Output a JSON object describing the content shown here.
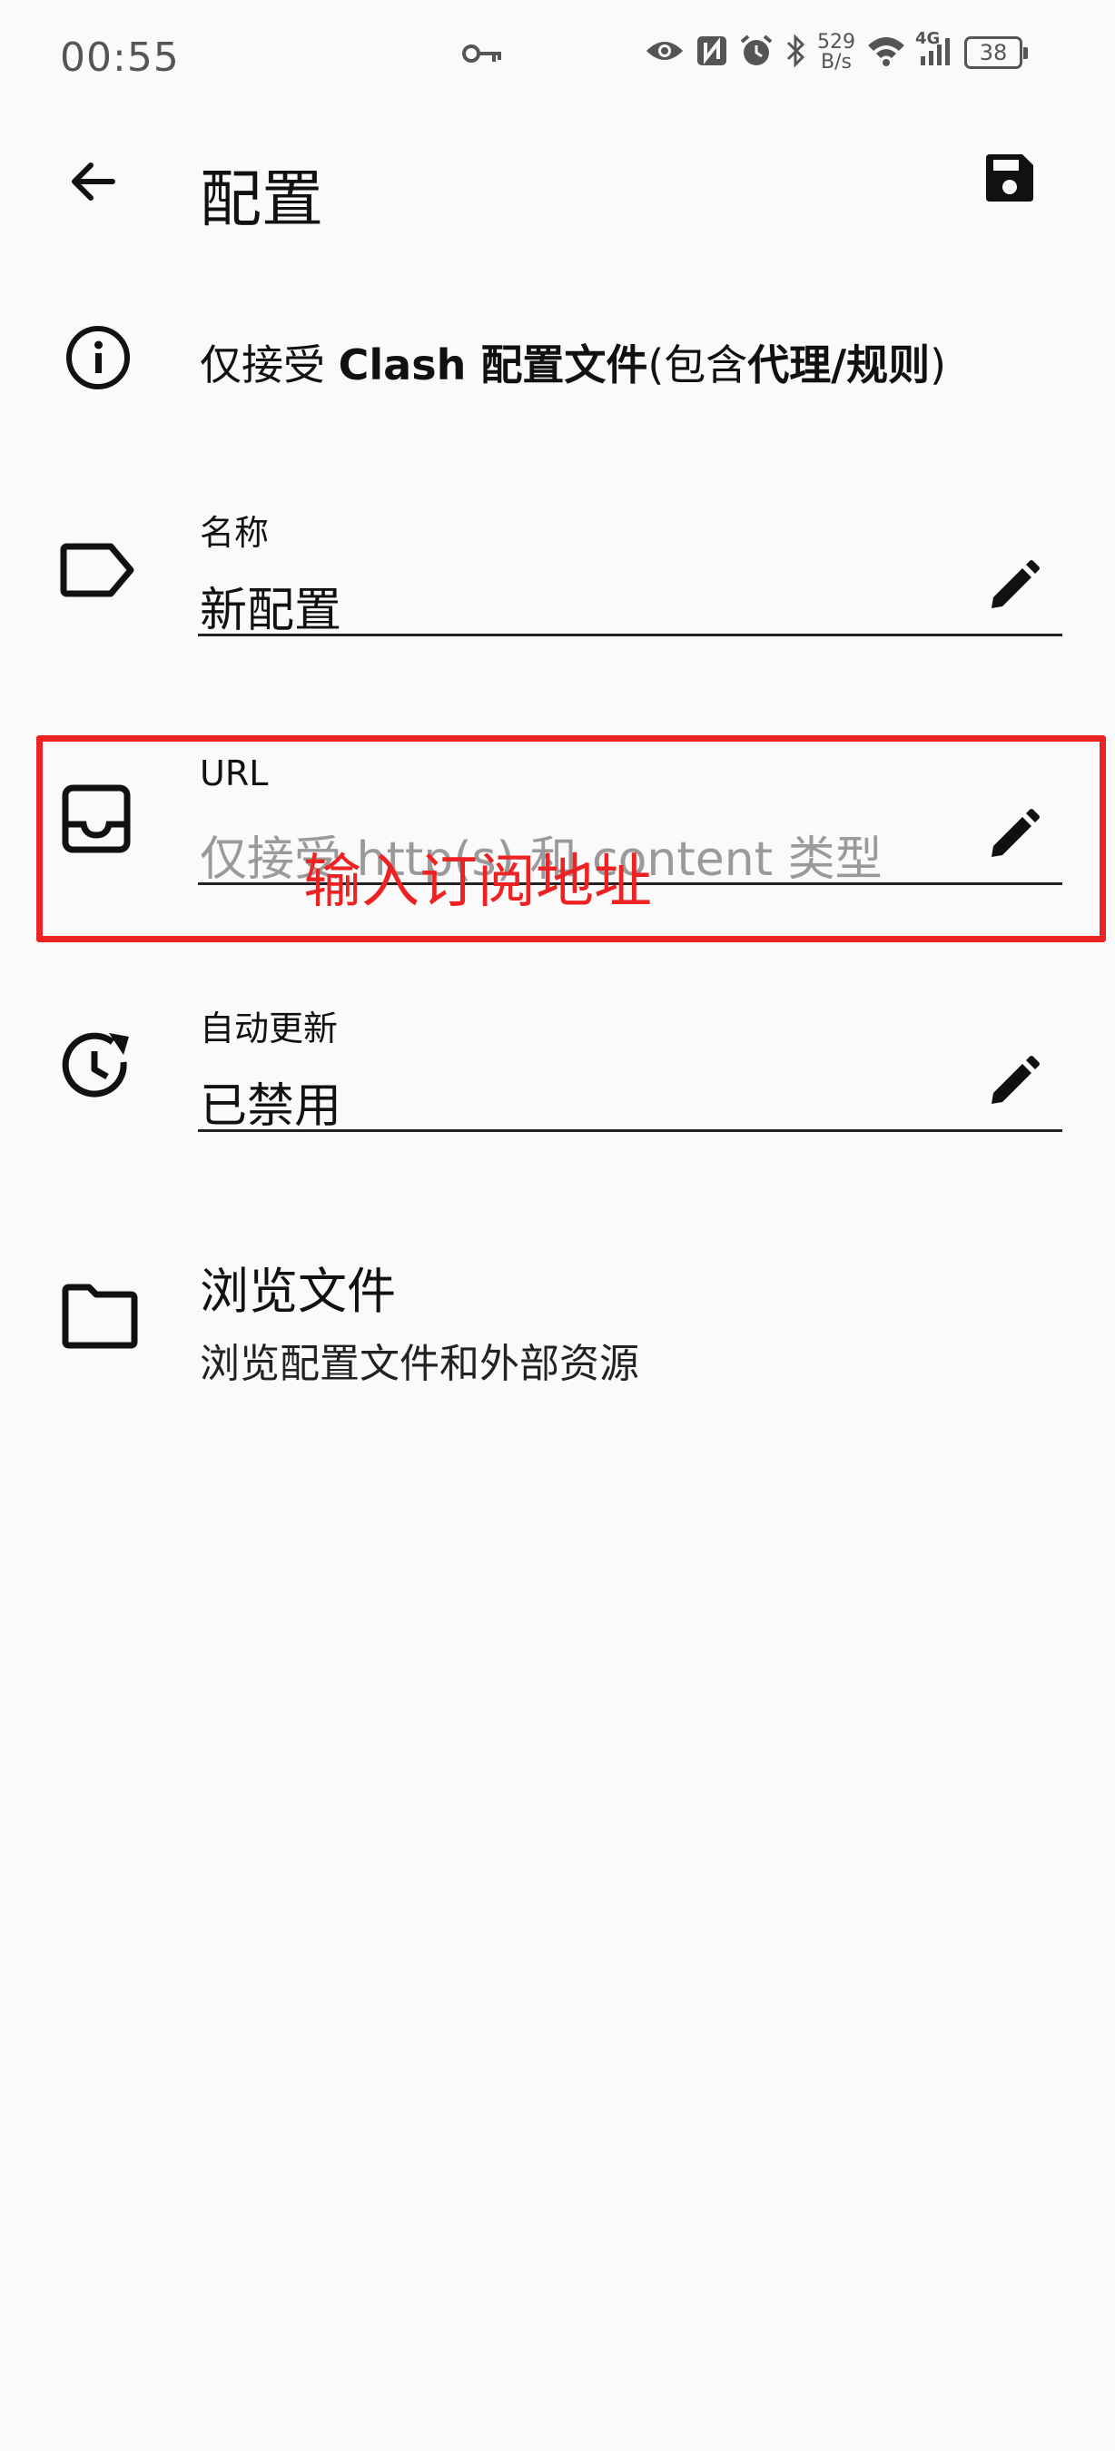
{
  "status_bar": {
    "time": "00:55",
    "icons": [
      "key-icon",
      "eye-icon",
      "nfc-icon",
      "alarm-icon",
      "bluetooth-icon",
      "wifi-icon",
      "signal-4g-icon"
    ],
    "net_speed_value": "529",
    "net_speed_unit": "B/s",
    "network_type": "4G",
    "battery": "38"
  },
  "app_bar": {
    "title": "配置",
    "back_icon": "arrow-back-icon",
    "save_icon": "save-icon"
  },
  "info": {
    "icon": "info-icon",
    "prefix": "仅接受 ",
    "bold1": "Clash 配置文件",
    "mid": "(包含",
    "bold2": "代理/规则",
    "suffix": ")"
  },
  "fields": {
    "name": {
      "label": "名称",
      "value": "新配置",
      "icon": "label-tag-icon"
    },
    "url": {
      "label": "URL",
      "placeholder": "仅接受 http(s) 和 content 类型",
      "icon": "inbox-icon"
    },
    "auto_update": {
      "label": "自动更新",
      "value": "已禁用",
      "icon": "update-clock-icon"
    }
  },
  "browse": {
    "title": "浏览文件",
    "subtitle": "浏览配置文件和外部资源",
    "icon": "folder-icon"
  },
  "annotation": {
    "text": "输入订阅地址",
    "color": "#ee2222"
  }
}
